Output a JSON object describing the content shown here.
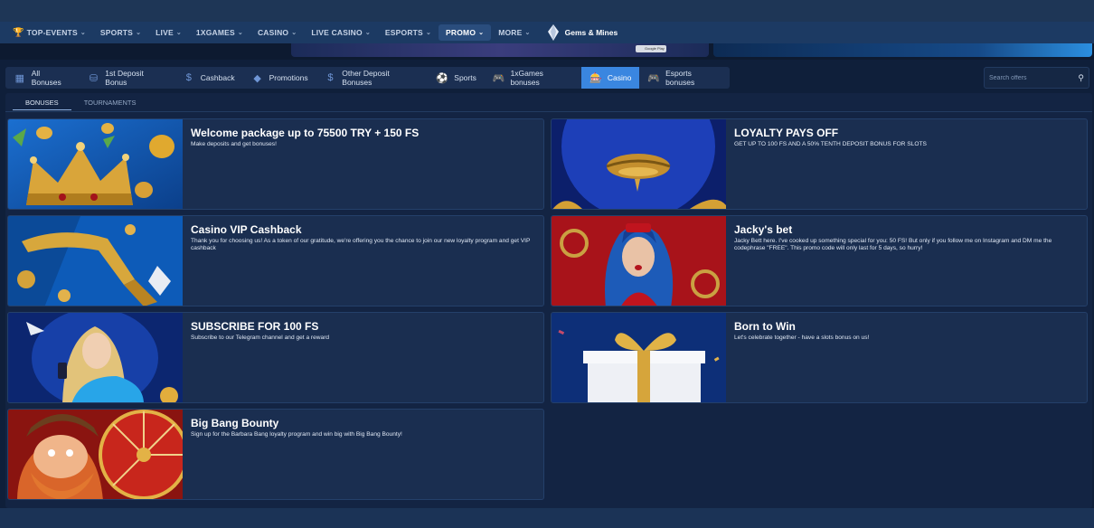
{
  "nav": {
    "items": [
      {
        "label": "TOP-EVENTS",
        "icon": "trophy-icon",
        "active": false
      },
      {
        "label": "SPORTS",
        "active": false
      },
      {
        "label": "LIVE",
        "active": false
      },
      {
        "label": "1XGAMES",
        "active": false
      },
      {
        "label": "CASINO",
        "active": false
      },
      {
        "label": "LIVE CASINO",
        "active": false
      },
      {
        "label": "ESPORTS",
        "active": false
      },
      {
        "label": "PROMO",
        "active": true
      },
      {
        "label": "MORE",
        "active": false
      }
    ],
    "gems_label": "Gems & Mines"
  },
  "banner": {
    "chip_text": "Google Play"
  },
  "filters": [
    {
      "label": "All Bonuses",
      "icon": "grid-icon",
      "active": false
    },
    {
      "label": "1st Deposit Bonus",
      "icon": "coins-icon",
      "active": false
    },
    {
      "label": "Cashback",
      "icon": "dollar-circle-icon",
      "active": false
    },
    {
      "label": "Promotions",
      "icon": "tag-icon",
      "active": false
    },
    {
      "label": "Other Deposit Bonuses",
      "icon": "dollar-icon",
      "active": false
    },
    {
      "label": "Sports",
      "icon": "soccer-ball-icon",
      "active": false
    },
    {
      "label": "1xGames bonuses",
      "icon": "gamepad-icon",
      "active": false
    },
    {
      "label": "Casino",
      "icon": "slot-machine-icon",
      "active": true
    },
    {
      "label": "Esports bonuses",
      "icon": "controller-icon",
      "active": false
    }
  ],
  "search": {
    "placeholder": "Search offers"
  },
  "subtabs": [
    {
      "label": "BONUSES",
      "active": true
    },
    {
      "label": "TOURNAMENTS",
      "active": false
    }
  ],
  "cards": [
    {
      "title": "Welcome package up to 75500 TRY + 150 FS",
      "desc": "Make deposits and get bonuses!",
      "image": "crown"
    },
    {
      "title": "LOYALTY PAYS OFF",
      "desc": "GET UP TO 100 FS AND A 50% TENTH DEPOSIT BONUS FOR SLOTS",
      "image": "lips"
    },
    {
      "title": "Casino VIP Cashback",
      "desc": "Thank you for choosing us! As a token of our gratitude, we're offering you the chance to join our new loyalty program and get VIP cashback",
      "image": "tap"
    },
    {
      "title": "Jacky's bet",
      "desc": "Jacky Bett here. I've cooked up something special for you: 50 FS! But only if you follow me on Instagram and DM me the codephrase \"FREE\". This promo code will only last for 5 days, so hurry!",
      "image": "jacky"
    },
    {
      "title": "SUBSCRIBE FOR 100 FS",
      "desc": "Subscribe to our Telegram channel and get a reward",
      "image": "phone-girl"
    },
    {
      "title": "Born to Win",
      "desc": "Let's celebrate together - have a slots bonus on us!",
      "image": "gift"
    },
    {
      "title": "Big Bang Bounty",
      "desc": "Sign up for the Barbara Bang loyalty program and win big with Big Bang Bounty!",
      "image": "pirate-wheel"
    }
  ]
}
